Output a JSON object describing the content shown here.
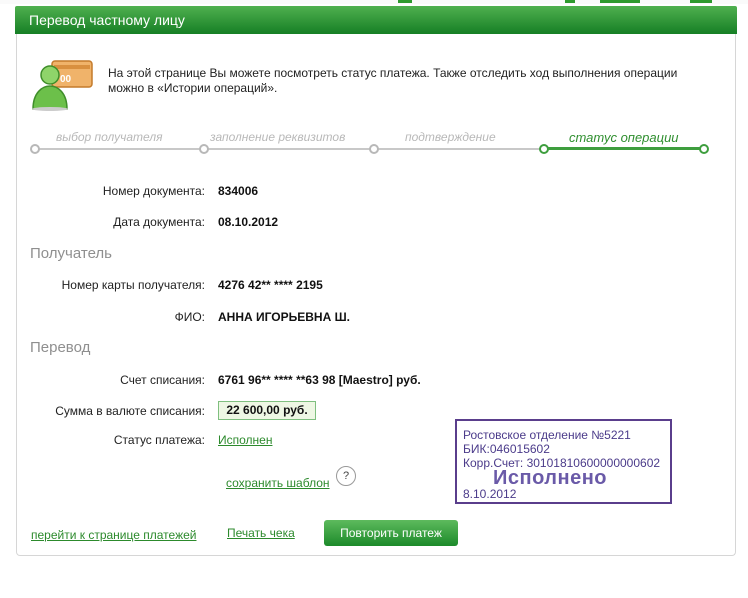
{
  "page": {
    "title": "Перевод частному лицу",
    "info_text": "На этой странице Вы можете посмотреть статус платежа. Также отследить ход выполнения операции можно в «Истории операций»."
  },
  "steps": [
    {
      "label": "выбор получателя",
      "active": false
    },
    {
      "label": "заполнение реквизитов",
      "active": false
    },
    {
      "label": "подтверждение",
      "active": false
    },
    {
      "label": "статус операции",
      "active": true
    }
  ],
  "document": {
    "number_label": "Номер документа:",
    "number_value": "834006",
    "date_label": "Дата документа:",
    "date_value": "08.10.2012"
  },
  "recipient": {
    "section_title": "Получатель",
    "card_label": "Номер карты получателя:",
    "card_value": "4276 42** **** 2195",
    "name_label": "ФИО:",
    "name_value": "АННА ИГОРЬЕВНА Ш."
  },
  "transfer": {
    "section_title": "Перевод",
    "account_label": "Счет списания:",
    "account_value": "6761 96** **** **63 98  [Maestro]  руб.",
    "amount_label": "Сумма в валюте списания:",
    "amount_value": "22 600,00  руб.",
    "status_label": "Статус платежа:",
    "status_value": "Исполнен"
  },
  "links": {
    "save_template": "сохранить шаблон",
    "help": "?",
    "go_payments": "перейти к странице платежей",
    "print_check": "Печать чека",
    "repeat_payment": "Повторить платеж"
  },
  "stamp": {
    "line1": "Ростовское отделение №5221",
    "line2": "БИК:046015602",
    "line3": "Корр.Счет: 30101810600000000602",
    "status": "Исполнено",
    "date": "8.10.2012"
  },
  "colors": {
    "brand_green": "#167f25",
    "stamp_purple": "#5a3e8c"
  }
}
